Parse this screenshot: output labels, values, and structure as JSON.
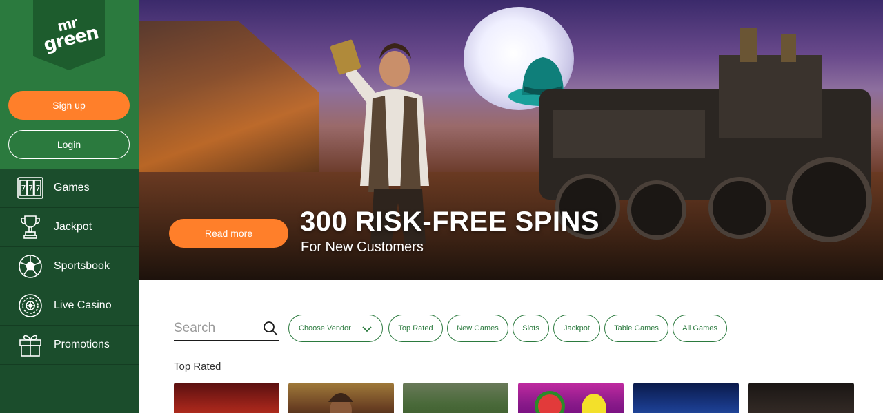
{
  "brand": {
    "logo_line1": "mr",
    "logo_line2": "green"
  },
  "auth": {
    "signup_label": "Sign up",
    "login_label": "Login"
  },
  "nav": {
    "items": [
      {
        "label": "Games",
        "icon": "slot-machine-icon"
      },
      {
        "label": "Jackpot",
        "icon": "trophy-icon"
      },
      {
        "label": "Sportsbook",
        "icon": "soccer-ball-icon"
      },
      {
        "label": "Live Casino",
        "icon": "roulette-icon"
      },
      {
        "label": "Promotions",
        "icon": "gift-icon"
      }
    ]
  },
  "hero": {
    "title": "300 RISK-FREE SPINS",
    "subtitle": "For New Customers",
    "cta_label": "Read more"
  },
  "filters": {
    "search_placeholder": "Search",
    "vendor_label": "Choose Vendor",
    "chips": [
      "Top Rated",
      "New Games",
      "Slots",
      "Jackpot",
      "Table Games",
      "All Games"
    ]
  },
  "section": {
    "title": "Top Rated"
  },
  "colors": {
    "brand_green": "#2b7a3e",
    "sidebar_dark": "#1b4d2c",
    "accent_orange": "#ff7f2a"
  }
}
